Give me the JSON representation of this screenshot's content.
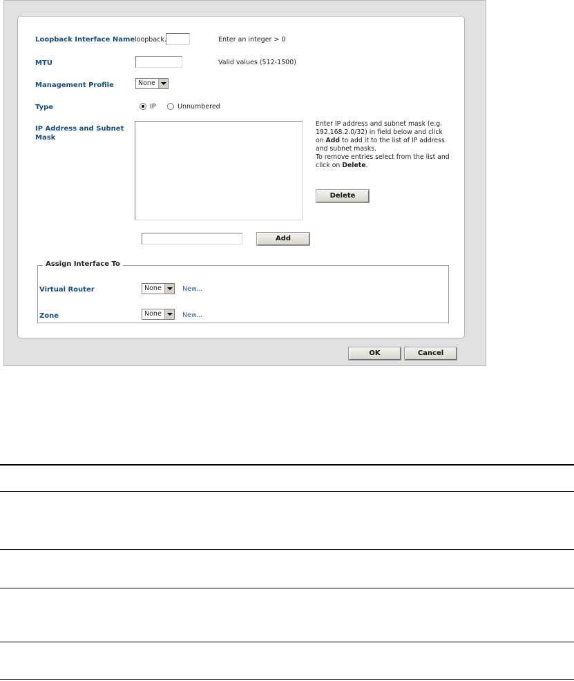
{
  "form": {
    "loopback": {
      "label": "Loopback Interface Name",
      "prefix": "loopback.",
      "value": "",
      "hint": "Enter an integer > 0"
    },
    "mtu": {
      "label": "MTU",
      "value": "",
      "hint": "Valid values (512-1500)"
    },
    "management_profile": {
      "label": "Management Profile",
      "selected": "None"
    },
    "type": {
      "label": "Type",
      "options": [
        "IP",
        "Unnumbered"
      ],
      "selected": "IP"
    },
    "ip_address": {
      "label": "IP Address and Subnet Mask",
      "help_1": "Enter IP address and subnet mask (e.g. 192.168.2.0/32) in field below and click on ",
      "help_add": "Add",
      "help_2": " to add it to the list of IP address and subnet masks.",
      "help_3": "To remove entries select from the list and click on ",
      "help_delete": "Delete",
      "help_4": ".",
      "delete_button": "Delete",
      "add_input": "",
      "add_button": "Add"
    },
    "assign": {
      "legend": "Assign Interface To",
      "virtual_router": {
        "label": "Virtual Router",
        "selected": "None",
        "new_link": "New..."
      },
      "zone": {
        "label": "Zone",
        "selected": "None",
        "new_link": "New..."
      }
    }
  },
  "dialog": {
    "ok_button": "OK",
    "cancel_button": "Cancel"
  },
  "colors": {
    "label_blue": "#154d82",
    "link_blue": "#2a5d9a",
    "window_gray": "#e1e1e1"
  }
}
